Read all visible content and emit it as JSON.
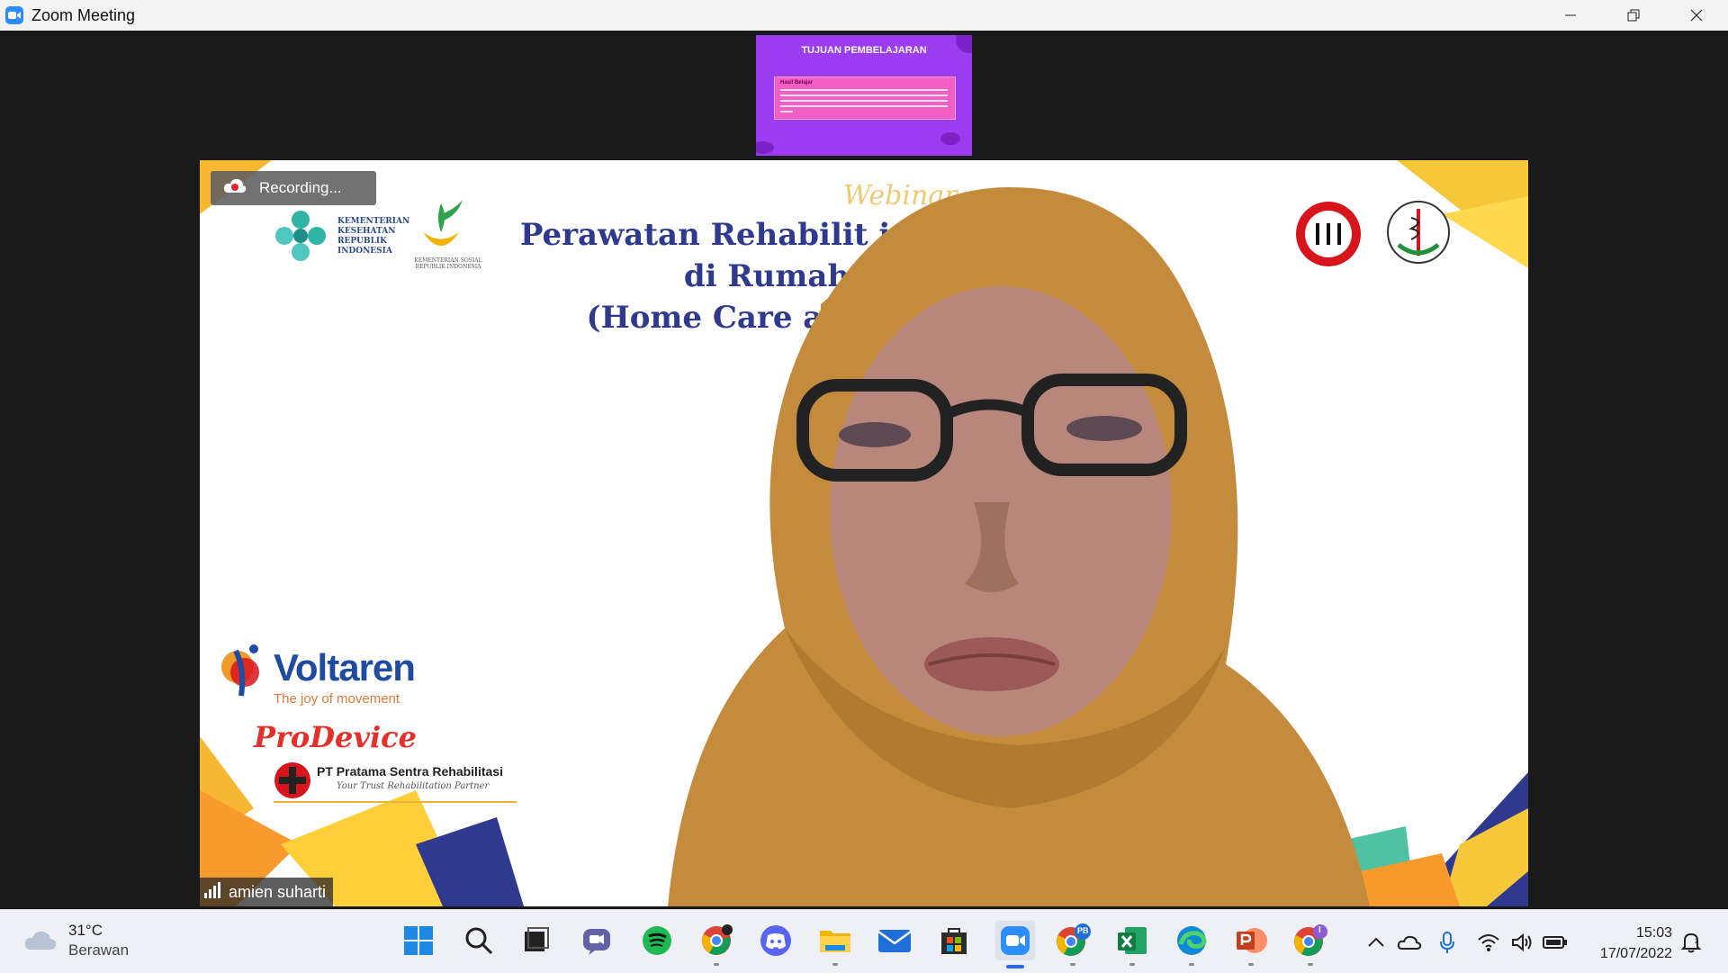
{
  "window": {
    "title": "Zoom Meeting",
    "accent": "#2d8cff"
  },
  "shared_screen": {
    "title": "TUJUAN PEMBELAJARAN",
    "box_heading": "Hasil Belajar",
    "background": "#9b3cf0"
  },
  "video": {
    "recording_label": "Recording...",
    "headline_line1": "Perawatan Rehabilit          i Pasien di Rumah",
    "headline_line2": "(Home Care                  at Dasar",
    "webinar_text": "Webinar",
    "kemenkes_text": "KEMENTERIAN KESEHATAN REPUBLIK INDONESIA",
    "kemensos_text": "KEMENTERIAN SOSIAL REPUBLIK INDONESIA",
    "sponsor_voltaren": "Voltaren",
    "sponsor_voltaren_tagline": "The joy of movement",
    "sponsor_prodevice": "ProDevice",
    "sponsor_pratama": "PT Pratama Sentra Rehabilitasi",
    "sponsor_pratama_sub": "Your Trust Rehabilitation Partner",
    "participant_name": "amien suharti"
  },
  "taskbar": {
    "weather_temp": "31°C",
    "weather_condition": "Berawan",
    "icons": [
      "windows-start",
      "search",
      "task-view",
      "teams-chat",
      "spotify",
      "chrome",
      "discord",
      "file-explorer",
      "mail",
      "microsoft-store",
      "zoom",
      "chrome-profile-pb",
      "excel",
      "edge",
      "powerpoint",
      "chrome-profile-i"
    ],
    "badge_pb": "PB",
    "badge_i": "I",
    "clock_time": "15:03",
    "clock_date": "17/07/2022"
  }
}
